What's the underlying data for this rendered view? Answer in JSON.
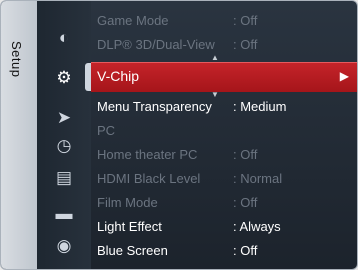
{
  "sidebar": {
    "label": "Setup"
  },
  "icons": [
    "picture-icon",
    "setup-gear-icon",
    "input-icon",
    "channel-dial-icon",
    "sound-icon",
    "display-icon",
    "speaker-icon"
  ],
  "menu": {
    "items": [
      {
        "label": "Game Mode",
        "value": ": Off"
      },
      {
        "label": "DLP® 3D/Dual-View",
        "value": ": Off"
      },
      {
        "label": "V-Chip",
        "value": ""
      },
      {
        "label": "Menu Transparency",
        "value": ": Medium"
      },
      {
        "label": "PC",
        "value": ""
      },
      {
        "label": "Home theater PC",
        "value": ": Off"
      },
      {
        "label": "HDMI Black Level",
        "value": ": Normal"
      },
      {
        "label": "Film Mode",
        "value": ": Off"
      },
      {
        "label": "Light Effect",
        "value": ": Always"
      },
      {
        "label": "Blue Screen",
        "value": ": Off"
      }
    ]
  }
}
